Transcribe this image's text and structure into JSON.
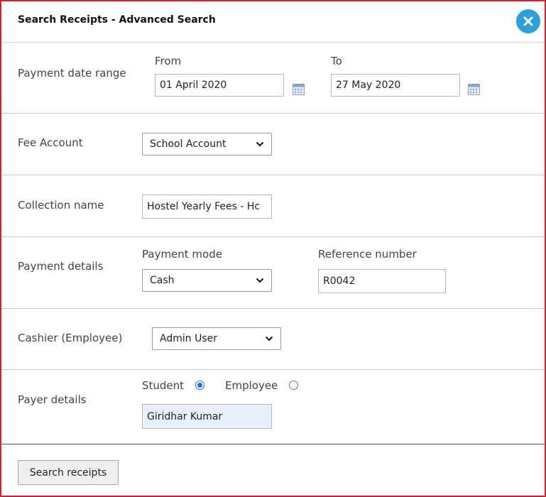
{
  "dialog": {
    "title": "Search Receipts - Advanced Search",
    "close_icon": "close-icon",
    "accent_color": "#2d9fd9",
    "border_color": "#d6202f"
  },
  "payment_date_range": {
    "label": "Payment date range",
    "from_label": "From",
    "from_value": "01 April 2020",
    "to_label": "To",
    "to_value": "27 May 2020",
    "calendar_icon": "calendar-icon"
  },
  "fee_account": {
    "label": "Fee Account",
    "selected": "School Account"
  },
  "collection_name": {
    "label": "Collection name",
    "value": "Hostel Yearly Fees - Hc"
  },
  "payment_details": {
    "label": "Payment details",
    "mode_label": "Payment mode",
    "mode_selected": "Cash",
    "reference_label": "Reference number",
    "reference_value": "R0042"
  },
  "cashier": {
    "label": "Cashier (Employee)",
    "selected": "Admin User"
  },
  "payer_details": {
    "label": "Payer details",
    "student_label": "Student",
    "student_checked": true,
    "employee_label": "Employee",
    "employee_checked": false,
    "payer_value": "Giridhar Kumar"
  },
  "footer": {
    "search_label": "Search receipts"
  }
}
